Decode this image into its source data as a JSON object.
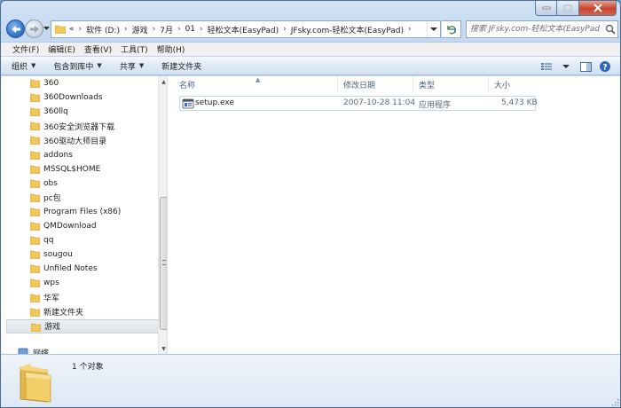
{
  "window": {
    "address": {
      "crumbs": [
        "«",
        "软件 (D:)",
        "游戏",
        "7月",
        "01",
        "轻松文本(EasyPad)",
        "JFsky.com-轻松文本(EasyPad)"
      ]
    },
    "search": {
      "placeholder": "搜索 JFsky.com-轻松文本(EasyPad)"
    }
  },
  "menubar": {
    "items": [
      "文件(F)",
      "编辑(E)",
      "查看(V)",
      "工具(T)",
      "帮助(H)"
    ]
  },
  "commandbar": {
    "organize": "组织",
    "include_library": "包含到库中",
    "share": "共享",
    "new_folder": "新建文件夹"
  },
  "nav_pane": {
    "folders": [
      "360",
      "360Downloads",
      "360llq",
      "360安全浏览器下载",
      "360驱动大师目录",
      "addons",
      "MSSQL$HOME",
      "obs",
      "pc包",
      "Program Files (x86)",
      "QMDownload",
      "qq",
      "sougou",
      "Unfiled Notes",
      "wps",
      "华军",
      "新建文件夹",
      "游戏"
    ],
    "selected_index": 17,
    "network_label": "网络"
  },
  "file_list": {
    "columns": [
      "名称",
      "修改日期",
      "类型",
      "大小"
    ],
    "rows": [
      {
        "name": "setup.exe",
        "modified": "2007-10-28 11:04",
        "type": "应用程序",
        "size": "5,473 KB"
      }
    ]
  },
  "details": {
    "summary": "1 个对象"
  },
  "colors": {
    "frame": "#c4d8ef",
    "selection_border": "#c7d6e8",
    "folder": "#f0c75a",
    "close_button": "#c8432b"
  }
}
